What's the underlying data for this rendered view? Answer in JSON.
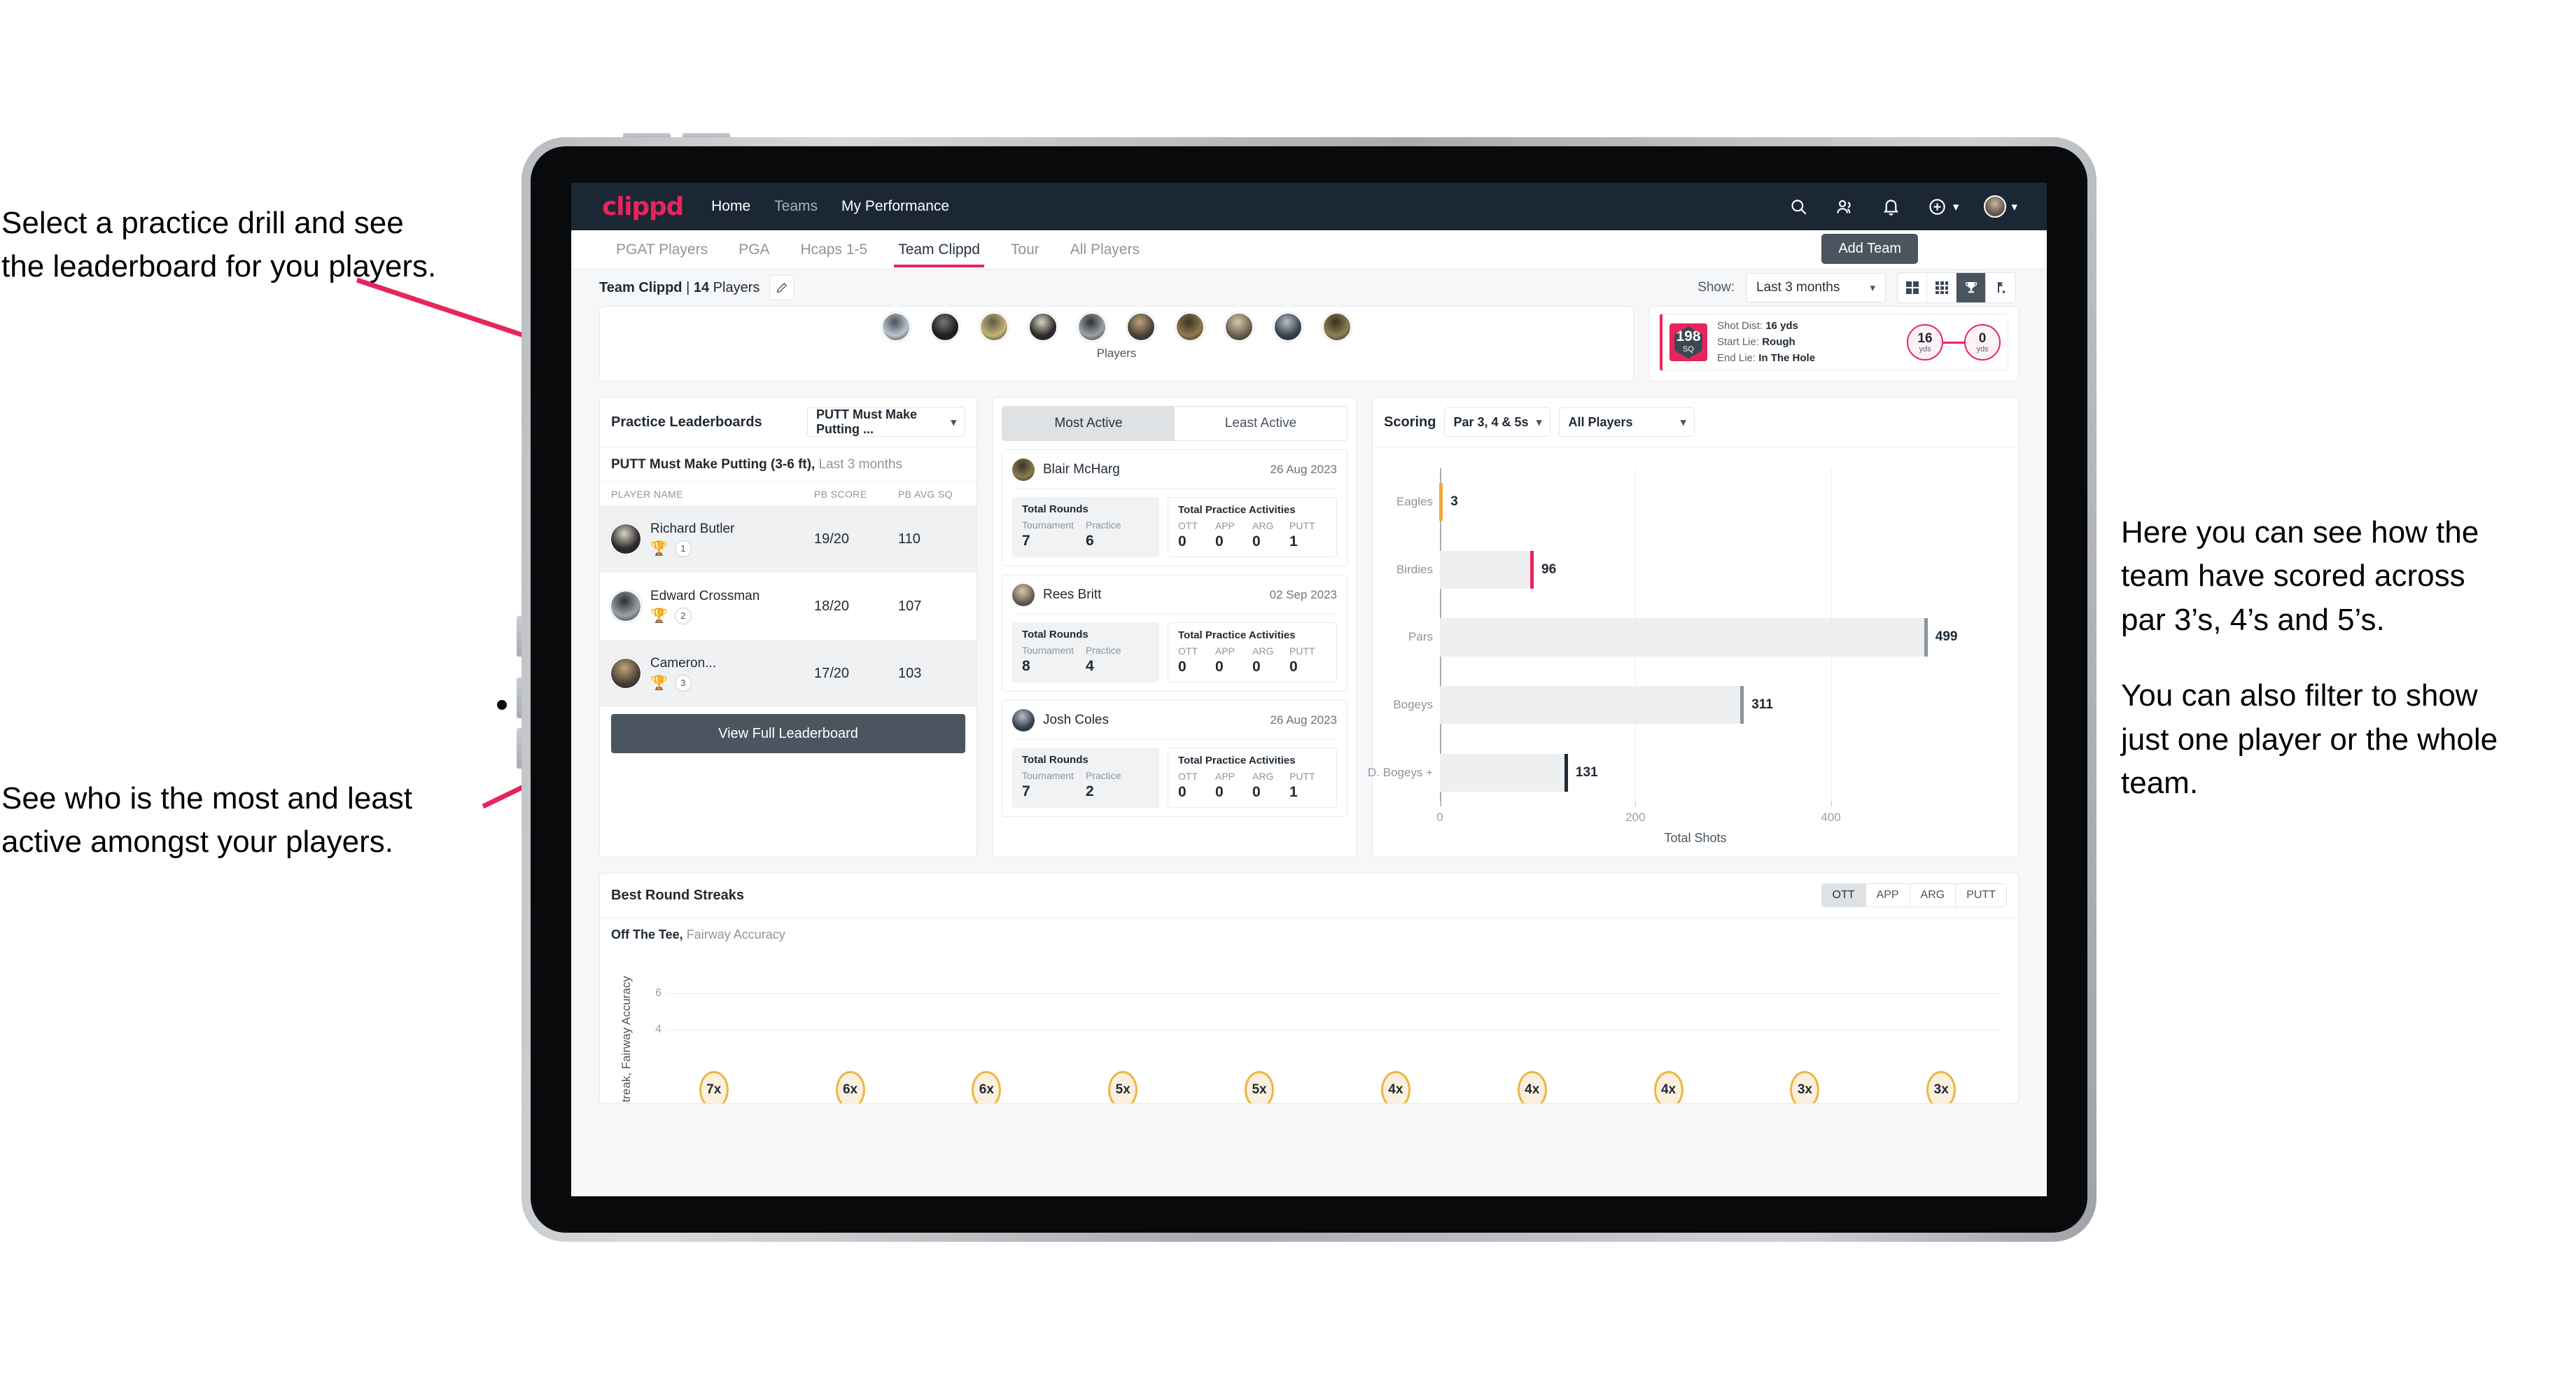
{
  "annotations": {
    "top_left": [
      "Select a practice drill and see",
      "the leaderboard for you players."
    ],
    "bottom_left": [
      "See who is the most and least",
      "active amongst your players."
    ],
    "right_1": [
      "Here you can see how the",
      "team have scored across",
      "par 3’s, 4’s and 5’s."
    ],
    "right_2": [
      "You can also filter to show",
      "just one player or the whole",
      "team."
    ]
  },
  "header": {
    "brand": "clippd",
    "nav": [
      {
        "label": "Home",
        "active": true
      },
      {
        "label": "Teams",
        "active": false
      },
      {
        "label": "My Performance",
        "active": true
      }
    ],
    "icons": [
      "search-icon",
      "people-icon",
      "bell-icon",
      "plus-circle-icon",
      "avatar"
    ]
  },
  "tabs": [
    {
      "label": "PGAT Players",
      "active": false
    },
    {
      "label": "PGA",
      "active": false
    },
    {
      "label": "Hcaps 1-5",
      "active": false
    },
    {
      "label": "Team Clippd",
      "active": true
    },
    {
      "label": "Tour",
      "active": false
    },
    {
      "label": "All Players",
      "active": false
    }
  ],
  "add_team_label": "Add Team",
  "subheader": {
    "team_name": "Team Clippd",
    "player_count": "14",
    "players_word": "Players",
    "separator": " | ",
    "show_label": "Show:",
    "period_value": "Last 3 months",
    "view_modes": [
      "grid-large-icon",
      "grid-small-icon",
      "trophy-icon",
      "flag-icon"
    ],
    "active_view_mode": "trophy-icon"
  },
  "players_strip": {
    "caption": "Players",
    "avatar_count": 10
  },
  "shot_card": {
    "sq_value": "198",
    "sq_unit": "SQ",
    "lines": [
      {
        "label": "Shot Dist:",
        "value": "16 yds"
      },
      {
        "label": "Start Lie:",
        "value": "Rough"
      },
      {
        "label": "End Lie:",
        "value": "In The Hole"
      }
    ],
    "start_distance": "16",
    "start_unit": "yds",
    "end_distance": "0",
    "end_unit": "yds"
  },
  "leaderboard": {
    "title": "Practice Leaderboards",
    "drill_select": "PUTT Must Make Putting ...",
    "subtitle_bold": "PUTT Must Make Putting (3-6 ft),",
    "subtitle_rest": " Last 3 months",
    "columns": [
      "PLAYER NAME",
      "PB SCORE",
      "PB AVG SQ"
    ],
    "rows": [
      {
        "name": "Richard Butler",
        "rank": "1",
        "trophy": "gold",
        "score": "19/20",
        "sq": "110"
      },
      {
        "name": "Edward Crossman",
        "rank": "2",
        "trophy": "silver",
        "score": "18/20",
        "sq": "107"
      },
      {
        "name": "Cameron...",
        "rank": "3",
        "trophy": "bronze",
        "score": "17/20",
        "sq": "103"
      }
    ],
    "button_label": "View Full Leaderboard"
  },
  "activity": {
    "tabs": [
      {
        "label": "Most Active",
        "active": true
      },
      {
        "label": "Least Active",
        "active": false
      }
    ],
    "rounds_title": "Total Rounds",
    "rounds_labels": [
      "Tournament",
      "Practice"
    ],
    "practice_title": "Total Practice Activities",
    "practice_labels": [
      "OTT",
      "APP",
      "ARG",
      "PUTT"
    ],
    "cards": [
      {
        "name": "Blair McHarg",
        "date": "26 Aug 2023",
        "tournament": "7",
        "practice": "6",
        "ott": "0",
        "app": "0",
        "arg": "0",
        "putt": "1"
      },
      {
        "name": "Rees Britt",
        "date": "02 Sep 2023",
        "tournament": "8",
        "practice": "4",
        "ott": "0",
        "app": "0",
        "arg": "0",
        "putt": "0"
      },
      {
        "name": "Josh Coles",
        "date": "26 Aug 2023",
        "tournament": "7",
        "practice": "2",
        "ott": "0",
        "app": "0",
        "arg": "0",
        "putt": "1"
      }
    ]
  },
  "scoring": {
    "title": "Scoring",
    "par_filter": "Par 3, 4 & 5s",
    "player_filter": "All Players"
  },
  "streaks": {
    "title": "Best Round Streaks",
    "toggle": [
      {
        "label": "OTT",
        "active": true
      },
      {
        "label": "APP",
        "active": false
      },
      {
        "label": "ARG",
        "active": false
      },
      {
        "label": "PUTT",
        "active": false
      }
    ],
    "subtitle_bold": "Off The Tee,",
    "subtitle_rest": " Fairway Accuracy"
  },
  "colors": {
    "brand_pink": "#e8245c",
    "header_navy": "#1b2735",
    "slate": "#4a5560",
    "gold": "#edb641",
    "bar_gray": "#edeff1"
  },
  "chart_data": [
    {
      "type": "bar",
      "orientation": "horizontal",
      "title": "Scoring",
      "categories": [
        "Eagles",
        "Birdies",
        "Pars",
        "Bogeys",
        "D. Bogeys +"
      ],
      "values": [
        3,
        96,
        499,
        311,
        131
      ],
      "cap_colors": [
        "#f0a93a",
        "#e8245c",
        "#8d959d",
        "#8d959d",
        "#1f2933"
      ],
      "xlabel": "Total Shots",
      "ylabel": "",
      "xlim": [
        0,
        540
      ],
      "xticks": [
        0,
        200,
        400
      ],
      "grid": true,
      "legend": "none"
    },
    {
      "type": "scatter",
      "subtype": "lollipop",
      "title": "Best Round Streaks",
      "series_label": "Off The Tee, Fairway Accuracy",
      "ylabel": "Streak, Fairway Accuracy",
      "values": [
        7,
        6,
        6,
        5,
        5,
        4,
        4,
        4,
        3,
        3
      ],
      "labels": [
        "7x",
        "6x",
        "6x",
        "5x",
        "5x",
        "4x",
        "4x",
        "4x",
        "3x",
        "3x"
      ],
      "yticks": [
        4,
        6
      ],
      "ylim": [
        0,
        8
      ],
      "grid": true,
      "marker_color": "#edb641",
      "note": "chart is clipped by viewport bottom"
    }
  ]
}
